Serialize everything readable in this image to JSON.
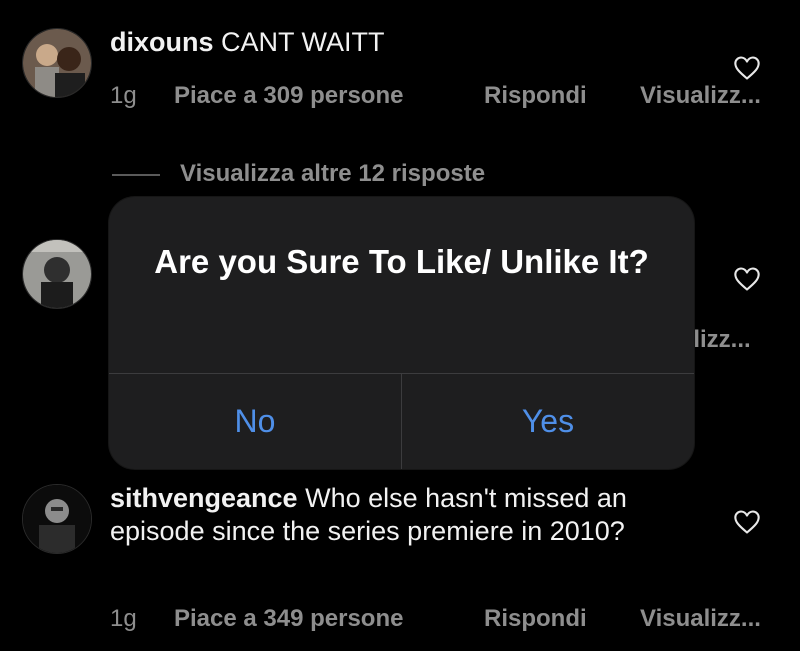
{
  "comments": [
    {
      "username": "dixouns",
      "text": "CANT WAITT",
      "time": "1g",
      "likes": "Piace a 309 persone",
      "reply": "Rispondi",
      "view": "Visualizz..."
    },
    {
      "username": "sithvengeance",
      "text": "Who else hasn't missed an episode since the series premiere in 2010?",
      "time": "1g",
      "likes": "Piace a 349 persone",
      "reply": "Rispondi",
      "view": "Visualizz..."
    }
  ],
  "view_more_replies": "Visualizza altre 12 risposte",
  "hidden_comment": {
    "view": "alizz..."
  },
  "dialog": {
    "title": "Are you Sure To Like/ Unlike It?",
    "no_label": "No",
    "yes_label": "Yes",
    "button_color": "#4f8fe8"
  },
  "icons": {
    "like": "heart-outline-icon"
  }
}
